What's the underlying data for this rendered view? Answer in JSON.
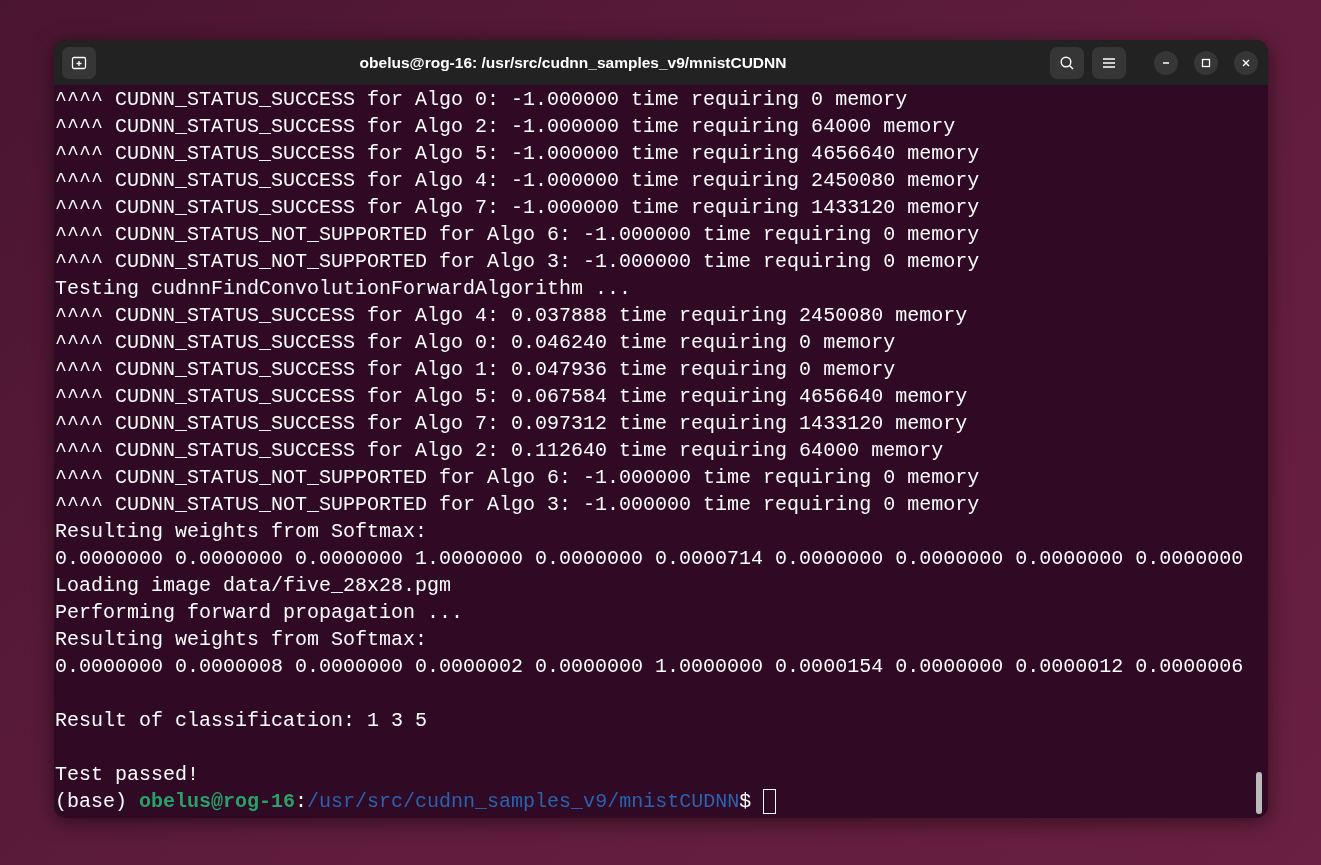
{
  "window": {
    "title": "obelus@rog-16: /usr/src/cudnn_samples_v9/mnistCUDNN"
  },
  "terminal": {
    "lines": [
      {
        "kind": "text",
        "text": "^^^^ CUDNN_STATUS_SUCCESS for Algo 0: -1.000000 time requiring 0 memory"
      },
      {
        "kind": "text",
        "text": "^^^^ CUDNN_STATUS_SUCCESS for Algo 2: -1.000000 time requiring 64000 memory"
      },
      {
        "kind": "text",
        "text": "^^^^ CUDNN_STATUS_SUCCESS for Algo 5: -1.000000 time requiring 4656640 memory"
      },
      {
        "kind": "text",
        "text": "^^^^ CUDNN_STATUS_SUCCESS for Algo 4: -1.000000 time requiring 2450080 memory"
      },
      {
        "kind": "text",
        "text": "^^^^ CUDNN_STATUS_SUCCESS for Algo 7: -1.000000 time requiring 1433120 memory"
      },
      {
        "kind": "text",
        "text": "^^^^ CUDNN_STATUS_NOT_SUPPORTED for Algo 6: -1.000000 time requiring 0 memory"
      },
      {
        "kind": "text",
        "text": "^^^^ CUDNN_STATUS_NOT_SUPPORTED for Algo 3: -1.000000 time requiring 0 memory"
      },
      {
        "kind": "text",
        "text": "Testing cudnnFindConvolutionForwardAlgorithm ..."
      },
      {
        "kind": "text",
        "text": "^^^^ CUDNN_STATUS_SUCCESS for Algo 4: 0.037888 time requiring 2450080 memory"
      },
      {
        "kind": "text",
        "text": "^^^^ CUDNN_STATUS_SUCCESS for Algo 0: 0.046240 time requiring 0 memory"
      },
      {
        "kind": "text",
        "text": "^^^^ CUDNN_STATUS_SUCCESS for Algo 1: 0.047936 time requiring 0 memory"
      },
      {
        "kind": "text",
        "text": "^^^^ CUDNN_STATUS_SUCCESS for Algo 5: 0.067584 time requiring 4656640 memory"
      },
      {
        "kind": "text",
        "text": "^^^^ CUDNN_STATUS_SUCCESS for Algo 7: 0.097312 time requiring 1433120 memory"
      },
      {
        "kind": "text",
        "text": "^^^^ CUDNN_STATUS_SUCCESS for Algo 2: 0.112640 time requiring 64000 memory"
      },
      {
        "kind": "text",
        "text": "^^^^ CUDNN_STATUS_NOT_SUPPORTED for Algo 6: -1.000000 time requiring 0 memory"
      },
      {
        "kind": "text",
        "text": "^^^^ CUDNN_STATUS_NOT_SUPPORTED for Algo 3: -1.000000 time requiring 0 memory"
      },
      {
        "kind": "text",
        "text": "Resulting weights from Softmax:"
      },
      {
        "kind": "text",
        "text": "0.0000000 0.0000000 0.0000000 1.0000000 0.0000000 0.0000714 0.0000000 0.0000000 0.0000000 0.0000000"
      },
      {
        "kind": "text",
        "text": "Loading image data/five_28x28.pgm"
      },
      {
        "kind": "text",
        "text": "Performing forward propagation ..."
      },
      {
        "kind": "text",
        "text": "Resulting weights from Softmax:"
      },
      {
        "kind": "text",
        "text": "0.0000000 0.0000008 0.0000000 0.0000002 0.0000000 1.0000000 0.0000154 0.0000000 0.0000012 0.0000006"
      },
      {
        "kind": "blank"
      },
      {
        "kind": "text",
        "text": "Result of classification: 1 3 5"
      },
      {
        "kind": "blank"
      },
      {
        "kind": "text",
        "text": "Test passed!"
      },
      {
        "kind": "prompt",
        "env": "(base)",
        "user_host": "obelus@rog-16",
        "separator": ":",
        "path": "/usr/src/cudnn_samples_v9/mnistCUDNN",
        "symbol": "$"
      }
    ]
  }
}
